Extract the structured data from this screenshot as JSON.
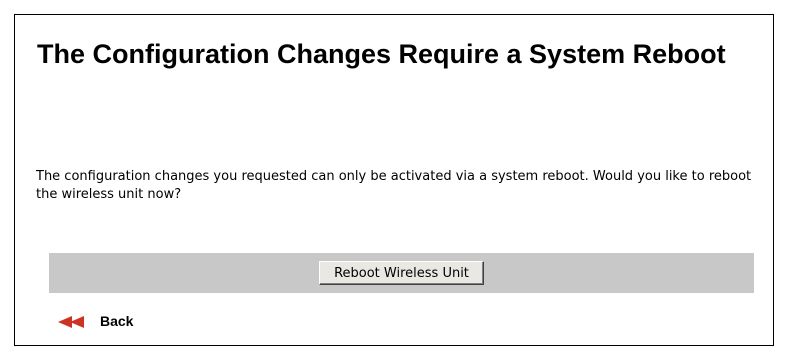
{
  "page": {
    "title": "The Configuration Changes Require a System Reboot",
    "message": "The configuration changes you requested can only be activated via a system reboot. Would you like to reboot the wireless unit now?"
  },
  "actions": {
    "reboot_label": "Reboot Wireless Unit"
  },
  "nav": {
    "back_label": "Back",
    "back_icon": "double-arrow-left-icon"
  },
  "colors": {
    "action_bar": "#c8c8c8",
    "back_arrow": "#cc3322",
    "button_face": "#eae8e2"
  }
}
